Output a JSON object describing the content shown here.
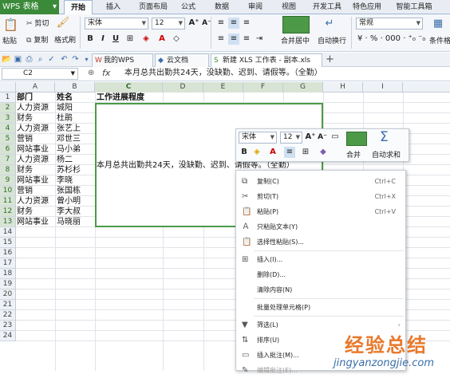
{
  "app": {
    "title": "WPS 表格"
  },
  "menubar": {
    "items": [
      "开始",
      "插入",
      "页面布局",
      "公式",
      "数据",
      "审阅",
      "视图",
      "开发工具",
      "特色应用",
      "智能工具箱"
    ],
    "active": "开始"
  },
  "ribbon": {
    "paste": "粘贴",
    "cut": "剪切",
    "copy": "复制",
    "format_painter": "格式刷",
    "font_name": "宋体",
    "font_size": "12",
    "merge_center": "合并居中",
    "auto_wrap": "自动换行",
    "number_format": "常规",
    "condition": "条件格"
  },
  "qab": {
    "tabs": [
      "我的WPS",
      "云文档",
      "新建 XLS 工作表 - 副本.xls"
    ],
    "add": "+"
  },
  "formula": {
    "cell_ref": "C2",
    "fx": "fx",
    "value": "本月总共出勤共24天，没缺勤、迟到、请假等。（全勤）"
  },
  "columns": [
    "A",
    "B",
    "C",
    "D",
    "E",
    "F",
    "G",
    "H",
    "I"
  ],
  "rows": [
    "1",
    "2",
    "3",
    "4",
    "5",
    "6",
    "7",
    "8",
    "9",
    "10",
    "11",
    "12",
    "13",
    "14",
    "15",
    "16",
    "17",
    "18",
    "19",
    "20",
    "21",
    "22",
    "23",
    "24"
  ],
  "headers": {
    "dept": "部门",
    "name": "姓名",
    "progress": "工作进展程度"
  },
  "data_rows": [
    {
      "dept": "人力资源",
      "name": "城阳"
    },
    {
      "dept": "财务",
      "name": "杜鹃"
    },
    {
      "dept": "人力资源",
      "name": "张艺上"
    },
    {
      "dept": "营销",
      "name": "邓世三"
    },
    {
      "dept": "网站事业",
      "name": "马小弟"
    },
    {
      "dept": "人力资源",
      "name": "杨二"
    },
    {
      "dept": "财务",
      "name": "苏杉杉"
    },
    {
      "dept": "网站事业",
      "name": "李晓"
    },
    {
      "dept": "营销",
      "name": "张国栋"
    },
    {
      "dept": "人力资源",
      "name": "曾小明"
    },
    {
      "dept": "财务",
      "name": "李大叔"
    },
    {
      "dept": "网站事业",
      "name": "马晓丽"
    }
  ],
  "merged_text": "本月总共出勤共24天，没缺勤、迟到、请假等。（全勤）",
  "mini_toolbar": {
    "font": "宋体",
    "size": "12",
    "merge": "合并",
    "autosum": "自动求和"
  },
  "context_menu": [
    {
      "label": "复制(C)",
      "shortcut": "Ctrl+C",
      "icon": "copy-icon"
    },
    {
      "label": "剪切(T)",
      "shortcut": "Ctrl+X",
      "icon": "scissors-icon"
    },
    {
      "label": "粘贴(P)",
      "shortcut": "Ctrl+V",
      "icon": "paste-icon"
    },
    {
      "label": "只粘贴文本(Y)",
      "shortcut": "",
      "icon": "paste-text-icon"
    },
    {
      "label": "选择性粘贴(S)...",
      "shortcut": "",
      "icon": "paste-special-icon"
    },
    {
      "label": "插入(I)...",
      "shortcut": "",
      "icon": "insert-icon"
    },
    {
      "label": "删除(D)...",
      "shortcut": "",
      "icon": ""
    },
    {
      "label": "清除内容(N)",
      "shortcut": "",
      "icon": ""
    },
    {
      "label": "批量处理单元格(P)",
      "shortcut": "",
      "icon": ""
    },
    {
      "label": "筛选(L)",
      "shortcut": "",
      "icon": "filter-icon",
      "submenu": true
    },
    {
      "label": "排序(U)",
      "shortcut": "",
      "icon": "sort-icon",
      "submenu": true
    },
    {
      "label": "插入批注(M)...",
      "shortcut": "",
      "icon": "comment-icon"
    },
    {
      "label": "编辑批注(E)...",
      "shortcut": "",
      "icon": "edit-comment-icon"
    }
  ],
  "watermark": {
    "cn": "经验总结",
    "url": "jingyanzongjie.com"
  },
  "colors": {
    "accent_green": "#3a8a3a",
    "selection": "#4c9a48",
    "watermark": "#e8792c"
  }
}
